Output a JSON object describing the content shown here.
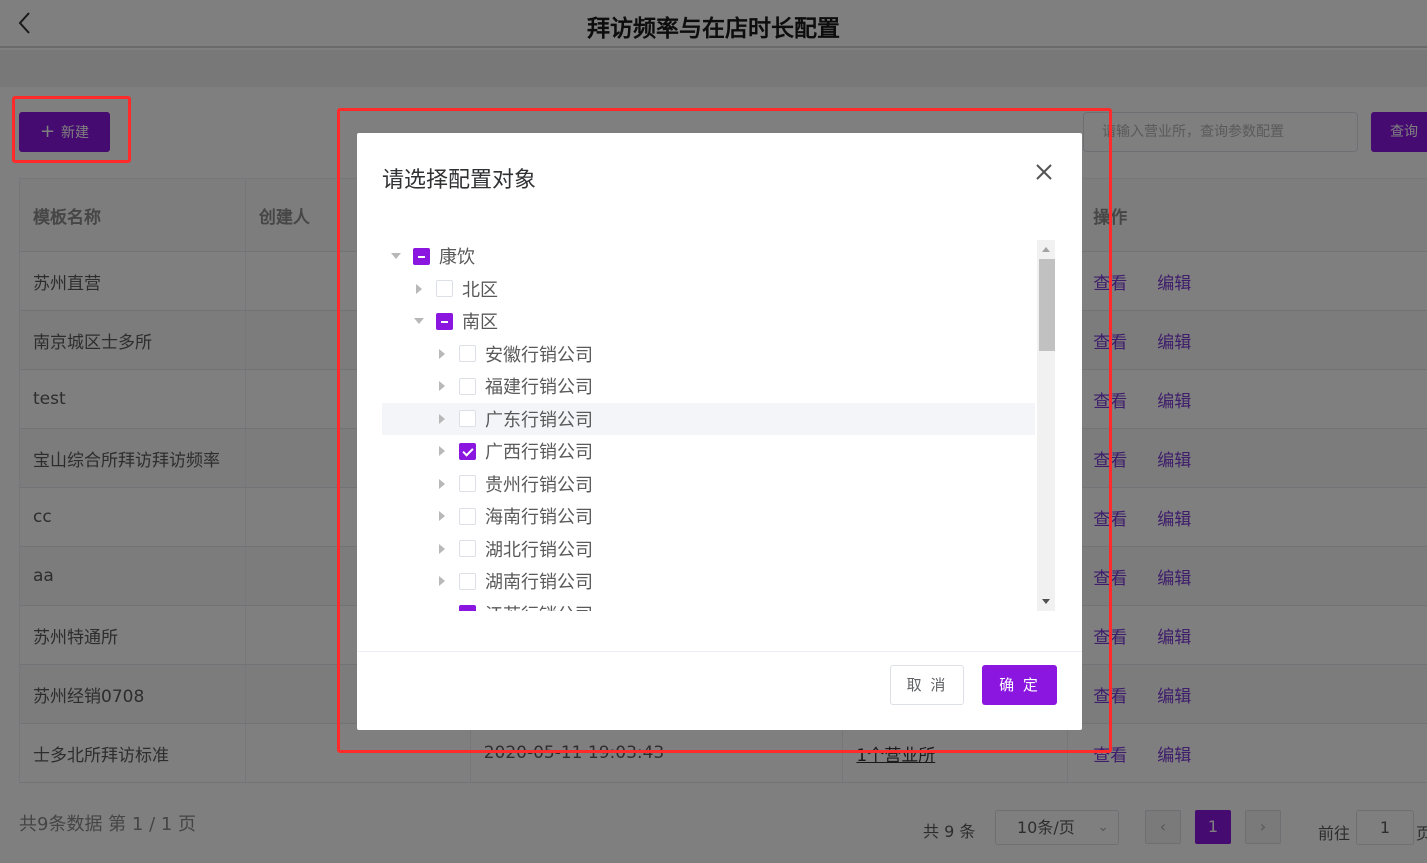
{
  "header": {
    "title": "拜访频率与在店时长配置"
  },
  "toolbar": {
    "new_label": "新建",
    "search_placeholder": "请输入营业所，查询参数配置",
    "query_label": "查询"
  },
  "table": {
    "columns": [
      "模板名称",
      "创建人",
      "",
      "",
      "操作"
    ],
    "rows": [
      {
        "name": "苏州直营",
        "creator": "",
        "time": "",
        "scope": ""
      },
      {
        "name": "南京城区士多所",
        "creator": "",
        "time": "",
        "scope": ""
      },
      {
        "name": "test",
        "creator": "",
        "time": "",
        "scope": ""
      },
      {
        "name": "宝山综合所拜访拜访频率",
        "creator": "",
        "time": "",
        "scope": ""
      },
      {
        "name": "cc",
        "creator": "",
        "time": "",
        "scope": ""
      },
      {
        "name": "aa",
        "creator": "",
        "time": "",
        "scope": ""
      },
      {
        "name": "苏州特通所",
        "creator": "",
        "time": "",
        "scope": ""
      },
      {
        "name": "苏州经销0708",
        "creator": "",
        "time": "",
        "scope": ""
      },
      {
        "name": "士多北所拜访标准",
        "creator": "",
        "time": "2020-05-11 19:03:43",
        "scope": "1个营业所"
      }
    ],
    "action_view": "查看",
    "action_edit": "编辑"
  },
  "pagination": {
    "summary": "共9条数据 第 1 / 1 页",
    "total": "共 9 条",
    "page_size": "10条/页",
    "current_page": "1",
    "goto_label": "前往",
    "goto_value": "1",
    "goto_suffix": "页"
  },
  "dialog": {
    "title": "请选择配置对象",
    "tree": [
      {
        "label": "康饮",
        "level": 0,
        "expanded": true,
        "state": "half"
      },
      {
        "label": "北区",
        "level": 1,
        "expanded": false,
        "state": "none"
      },
      {
        "label": "南区",
        "level": 1,
        "expanded": true,
        "state": "half"
      },
      {
        "label": "安徽行销公司",
        "level": 2,
        "expanded": false,
        "state": "none"
      },
      {
        "label": "福建行销公司",
        "level": 2,
        "expanded": false,
        "state": "none"
      },
      {
        "label": "广东行销公司",
        "level": 2,
        "expanded": false,
        "state": "none",
        "hover": true
      },
      {
        "label": "广西行销公司",
        "level": 2,
        "expanded": false,
        "state": "checked"
      },
      {
        "label": "贵州行销公司",
        "level": 2,
        "expanded": false,
        "state": "none"
      },
      {
        "label": "海南行销公司",
        "level": 2,
        "expanded": false,
        "state": "none"
      },
      {
        "label": "湖北行销公司",
        "level": 2,
        "expanded": false,
        "state": "none"
      },
      {
        "label": "湖南行销公司",
        "level": 2,
        "expanded": false,
        "state": "none"
      },
      {
        "label": "江苏行销公司",
        "level": 2,
        "expanded": true,
        "state": "half"
      }
    ],
    "cancel_label": "取 消",
    "ok_label": "确 定"
  },
  "colors": {
    "accent": "#8a16e0",
    "highlight": "#ff2b2b"
  }
}
